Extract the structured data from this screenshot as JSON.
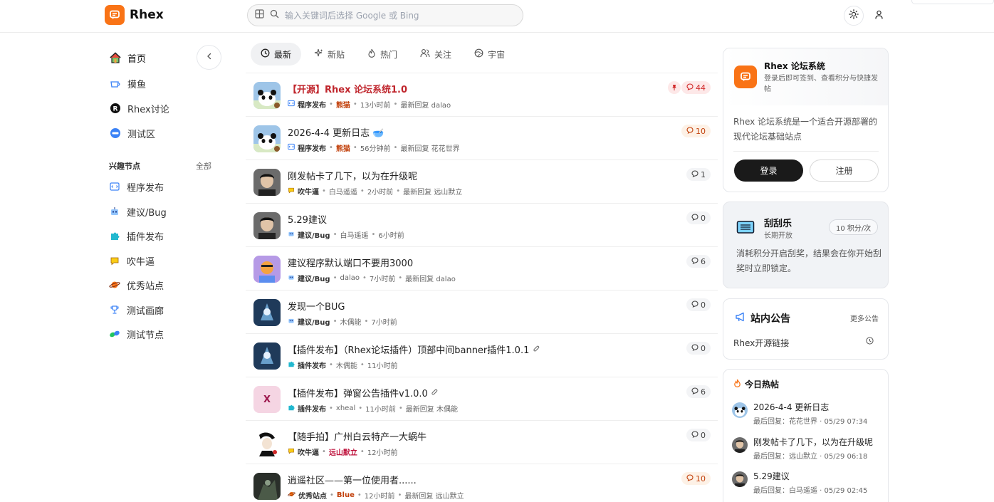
{
  "header": {
    "brand": "Rhex",
    "search_placeholder": "输入关键词后选择 Google 或 Bing"
  },
  "nav": {
    "items": [
      {
        "label": "首页",
        "icon": "home-icon"
      },
      {
        "label": "摸鱼",
        "icon": "coffee-cup-icon"
      },
      {
        "label": "Rhex讨论",
        "icon": "r-circle-icon"
      },
      {
        "label": "测试区",
        "icon": "test-badge-icon"
      }
    ],
    "section_title": "兴趣节点",
    "section_all": "全部",
    "nodes": [
      {
        "label": "程序发布",
        "icon": "code-icon"
      },
      {
        "label": "建议/Bug",
        "icon": "robot-icon"
      },
      {
        "label": "插件发布",
        "icon": "puzzle-icon"
      },
      {
        "label": "吹牛逼",
        "icon": "chat-bubble-icon"
      },
      {
        "label": "优秀站点",
        "icon": "planet-icon"
      },
      {
        "label": "测试画廊",
        "icon": "trophy-icon"
      },
      {
        "label": "测试节点",
        "icon": "leaf-icon"
      }
    ]
  },
  "tabs": [
    {
      "label": "最新",
      "icon": "clock-icon",
      "active": true
    },
    {
      "label": "新贴",
      "icon": "sparkle-icon"
    },
    {
      "label": "热门",
      "icon": "flame-icon"
    },
    {
      "label": "关注",
      "icon": "users-icon"
    },
    {
      "label": "宇宙",
      "icon": "globe-icon"
    }
  ],
  "posts": [
    {
      "title": "【开源】Rhex 论坛系统1.0",
      "pinned": true,
      "category": "程序发布",
      "author": "熊猫",
      "author_style": "hl",
      "time": "13小时前",
      "reply": "最新回复 dalao",
      "count": "44",
      "badge": "hot",
      "avatar_color": "#9ec5e8"
    },
    {
      "title": "2026-4-4 更新日志 🥣",
      "category": "程序发布",
      "author": "熊猫",
      "author_style": "hl",
      "time": "56分钟前",
      "reply": "最新回复 花花世界",
      "count": "10",
      "badge": "warm",
      "avatar_color": "#9ec5e8"
    },
    {
      "title": "刚发帖卡了几下，以为在升级呢",
      "category": "吹牛逼",
      "author": "白马遥遥",
      "time": "2小时前",
      "reply": "最新回复 远山默立",
      "count": "1",
      "avatar_color": "#3b3b3b"
    },
    {
      "title": "5.29建议",
      "category": "建议/Bug",
      "author": "白马遥遥",
      "time": "6小时前",
      "reply": "",
      "count": "0",
      "avatar_color": "#3b3b3b"
    },
    {
      "title": "建议程序默认端口不要用3000",
      "category": "建议/Bug",
      "author": "dalao",
      "time": "7小时前",
      "reply": "最新回复 dalao",
      "count": "6",
      "avatar_color": "#b69ae6"
    },
    {
      "title": "发现一个BUG",
      "category": "建议/Bug",
      "author": "木偶能",
      "time": "7小时前",
      "reply": "",
      "count": "0",
      "avatar_color": "#1f3a5a"
    },
    {
      "title": "【插件发布】（Rhex论坛插件）顶部中间banner插件1.0.1",
      "clip": true,
      "category": "插件发布",
      "author": "木偶能",
      "time": "11小时前",
      "reply": "",
      "count": "0",
      "avatar_color": "#1f3a5a"
    },
    {
      "title": "【插件发布】弹窗公告插件v1.0.0",
      "clip": true,
      "category": "插件发布",
      "author": "xheal",
      "time": "11小时前",
      "reply": "最新回复 木偶能",
      "count": "6",
      "avatar_color": "#f5d5e3",
      "avatar_letter": "X"
    },
    {
      "title": "【随手拍】广州白云特产一大蜗牛",
      "category": "吹牛逼",
      "author": "远山默立",
      "author_style": "red",
      "time": "12小时前",
      "reply": "",
      "count": "0",
      "avatar_color": "#ffffff"
    },
    {
      "title": "逍遥社区——第一位使用者......",
      "category": "优秀站点",
      "author": "Blue",
      "author_style": "hl",
      "time": "12小时前",
      "reply": "最新回复 远山默立",
      "count": "10",
      "badge": "warm",
      "avatar_color": "#2a2f2a"
    }
  ],
  "site_card": {
    "name": "Rhex 论坛系统",
    "subtitle": "登录后即可签到、查看积分与快捷发帖",
    "desc": "Rhex 论坛系统是一个适合开源部署的现代论坛基础站点",
    "login": "登录",
    "register": "注册"
  },
  "lottery": {
    "title": "刮刮乐",
    "sub": "长期开放",
    "badge": "10 积分/次",
    "desc": "消耗积分开启刮奖，结果会在你开始刮奖时立即锁定。"
  },
  "notice": {
    "title": "站内公告",
    "more": "更多公告",
    "item": "Rhex开源链接"
  },
  "hot_today": {
    "title": "今日热帖",
    "items": [
      {
        "title": "2026-4-4 更新日志",
        "sub": "最后回复：花花世界 · 05/29 07:34",
        "avatar_color": "#9ec5e8"
      },
      {
        "title": "刚发帖卡了几下，以为在升级呢",
        "sub": "最后回复：远山默立 · 05/29 06:18",
        "avatar_color": "#3b3b3b"
      },
      {
        "title": "5.29建议",
        "sub": "最后回复：白马遥遥 · 05/29 02:45",
        "avatar_color": "#3b3b3b"
      }
    ]
  },
  "colors": {
    "brand": "#f97316",
    "pinned_title": "#c0262d",
    "login_bg": "#1a1a1a"
  }
}
